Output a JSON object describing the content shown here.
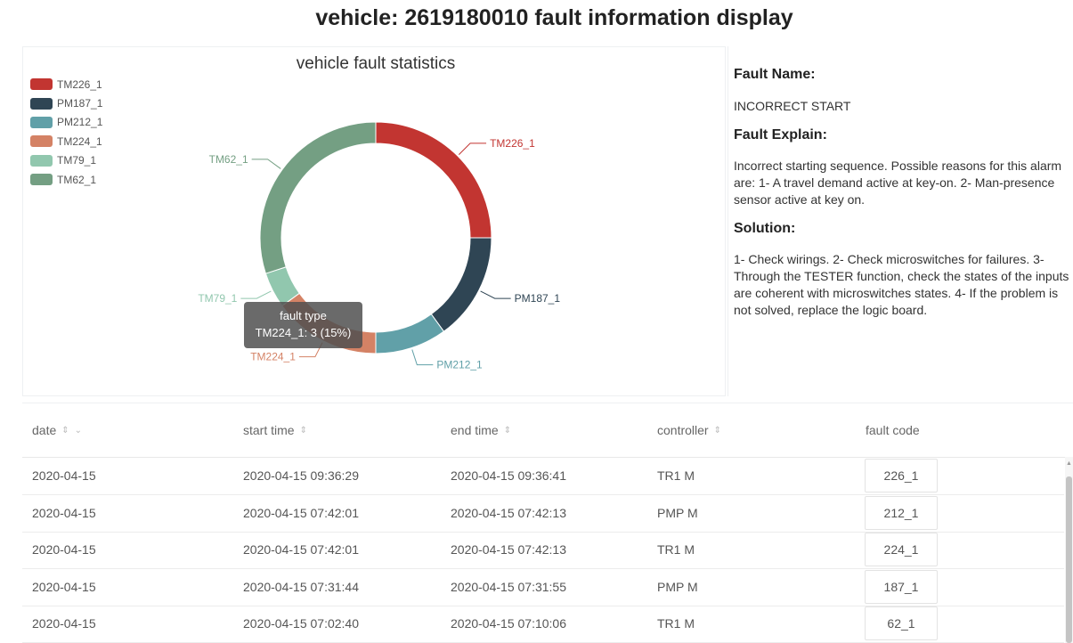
{
  "page_title": "vehicle: 2619180010 fault information display",
  "chart_data": {
    "type": "pie",
    "title": "vehicle fault statistics",
    "categories": [
      "TM226_1",
      "PM187_1",
      "PM212_1",
      "TM224_1",
      "TM79_1",
      "TM62_1"
    ],
    "values": [
      5,
      3,
      2,
      3,
      1,
      6
    ],
    "colors": [
      "#c23531",
      "#2f4554",
      "#61a0a8",
      "#d48265",
      "#91c7ae",
      "#749f83"
    ],
    "legend_position": "top-left",
    "tooltip": {
      "title": "fault type",
      "text": "TM224_1: 3 (15%)"
    }
  },
  "fault_info": {
    "name_heading": "Fault Name:",
    "name": "INCORRECT START",
    "explain_heading": "Fault Explain:",
    "explain": "Incorrect starting sequence. Possible reasons for this alarm are: 1- A travel demand active at key-on. 2- Man-presence sensor active at key on.",
    "solution_heading": "Solution:",
    "solution": "1- Check wirings. 2- Check microswitches for failures. 3- Through the TESTER function, check the states of the inputs are coherent with microswitches states. 4- If the problem is not solved, replace the logic board."
  },
  "table": {
    "columns": [
      "date",
      "start time",
      "end time",
      "controller",
      "fault code"
    ],
    "rows": [
      [
        "2020-04-15",
        "2020-04-15 09:36:29",
        "2020-04-15 09:36:41",
        "TR1 M",
        "226_1"
      ],
      [
        "2020-04-15",
        "2020-04-15 07:42:01",
        "2020-04-15 07:42:13",
        "PMP M",
        "212_1"
      ],
      [
        "2020-04-15",
        "2020-04-15 07:42:01",
        "2020-04-15 07:42:13",
        "TR1 M",
        "224_1"
      ],
      [
        "2020-04-15",
        "2020-04-15 07:31:44",
        "2020-04-15 07:31:55",
        "PMP M",
        "187_1"
      ],
      [
        "2020-04-15",
        "2020-04-15 07:02:40",
        "2020-04-15 07:10:06",
        "TR1 M",
        "62_1"
      ]
    ]
  },
  "icons": {
    "sort": "sort-icon",
    "filter": "chevron-down-icon"
  }
}
